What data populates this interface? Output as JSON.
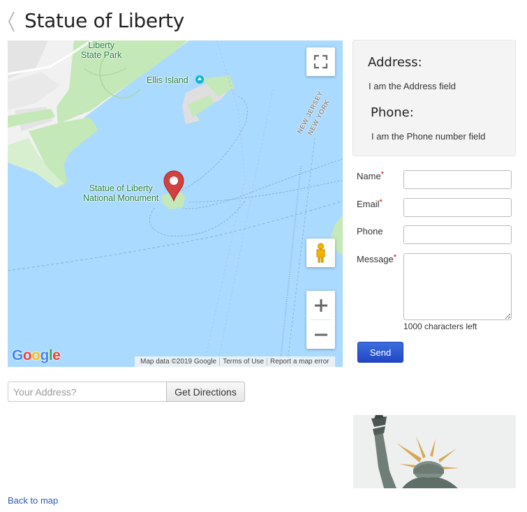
{
  "page": {
    "title": "Statue of Liberty",
    "back_link": "Back to map"
  },
  "map": {
    "labels": {
      "liberty_state_park": "Liberty\nState Park",
      "ellis_island": "Ellis Island",
      "statue_monument": "Statue of Liberty\nNational Monument",
      "new_jersey": "NEW JERSEY",
      "new_york": "NEW YORK"
    },
    "google_logo": "Google",
    "attribution": {
      "map_data": "Map data ©2019 Google",
      "terms": "Terms of Use",
      "report": "Report a map error"
    },
    "zoom_in_symbol": "+",
    "zoom_out_symbol": "−",
    "colors": {
      "water": "#aadaff",
      "park": "#c4e8b7",
      "land": "#f1f1f1",
      "marker": "#d0413f"
    }
  },
  "info": {
    "address_heading": "Address:",
    "address_text": "I am the Address field",
    "phone_heading": "Phone:",
    "phone_text": "I am the Phone number field"
  },
  "form": {
    "name_label": "Name",
    "email_label": "Email",
    "phone_label": "Phone",
    "message_label": "Message",
    "required_mark": "*",
    "name_value": "",
    "email_value": "",
    "phone_value": "",
    "message_value": "",
    "chars_left": "1000 characters left",
    "send_label": "Send"
  },
  "directions": {
    "placeholder": "Your Address?",
    "button_label": "Get Directions"
  }
}
